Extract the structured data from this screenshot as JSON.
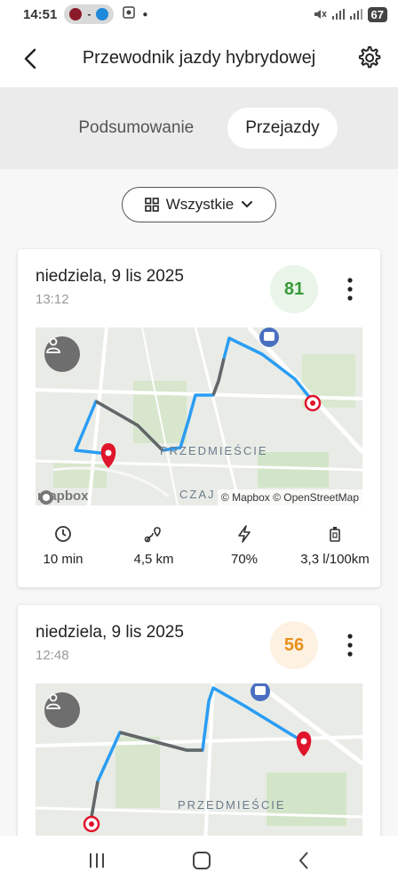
{
  "status_bar": {
    "time": "14:51",
    "battery": "67"
  },
  "header": {
    "title": "Przewodnik jazdy hybrydowej",
    "back_icon": "chevron-left-icon",
    "settings_icon": "gear-icon"
  },
  "tabs": [
    {
      "label": "Podsumowanie",
      "active": false
    },
    {
      "label": "Przejazdy",
      "active": true
    }
  ],
  "filter": {
    "label": "Wszystkie",
    "icon": "grid-icon",
    "chevron_icon": "chevron-down-icon"
  },
  "trips": [
    {
      "date": "niedziela, 9 lis 2025",
      "time": "13:12",
      "score": "81",
      "score_color": "#3a9a3a",
      "map": {
        "district": "PRZEDMIEŚCIE",
        "area": "CZAJ",
        "attribution": "© Mapbox © OpenStreetMap",
        "logo": "mapbox"
      },
      "stats": [
        {
          "icon": "clock-icon",
          "value": "10 min"
        },
        {
          "icon": "route-icon",
          "value": "4,5 km"
        },
        {
          "icon": "bolt-icon",
          "value": "70%"
        },
        {
          "icon": "fuel-icon",
          "value": "3,3 l/100km"
        }
      ]
    },
    {
      "date": "niedziela, 9 lis 2025",
      "time": "12:48",
      "score": "56",
      "score_color": "#e8901b",
      "map": {
        "district": "PRZEDMIEŚCIE"
      }
    }
  ],
  "colors": {
    "route_electric": "#2a9df4",
    "route_fuel": "#666666",
    "pin": "#e0142b"
  }
}
